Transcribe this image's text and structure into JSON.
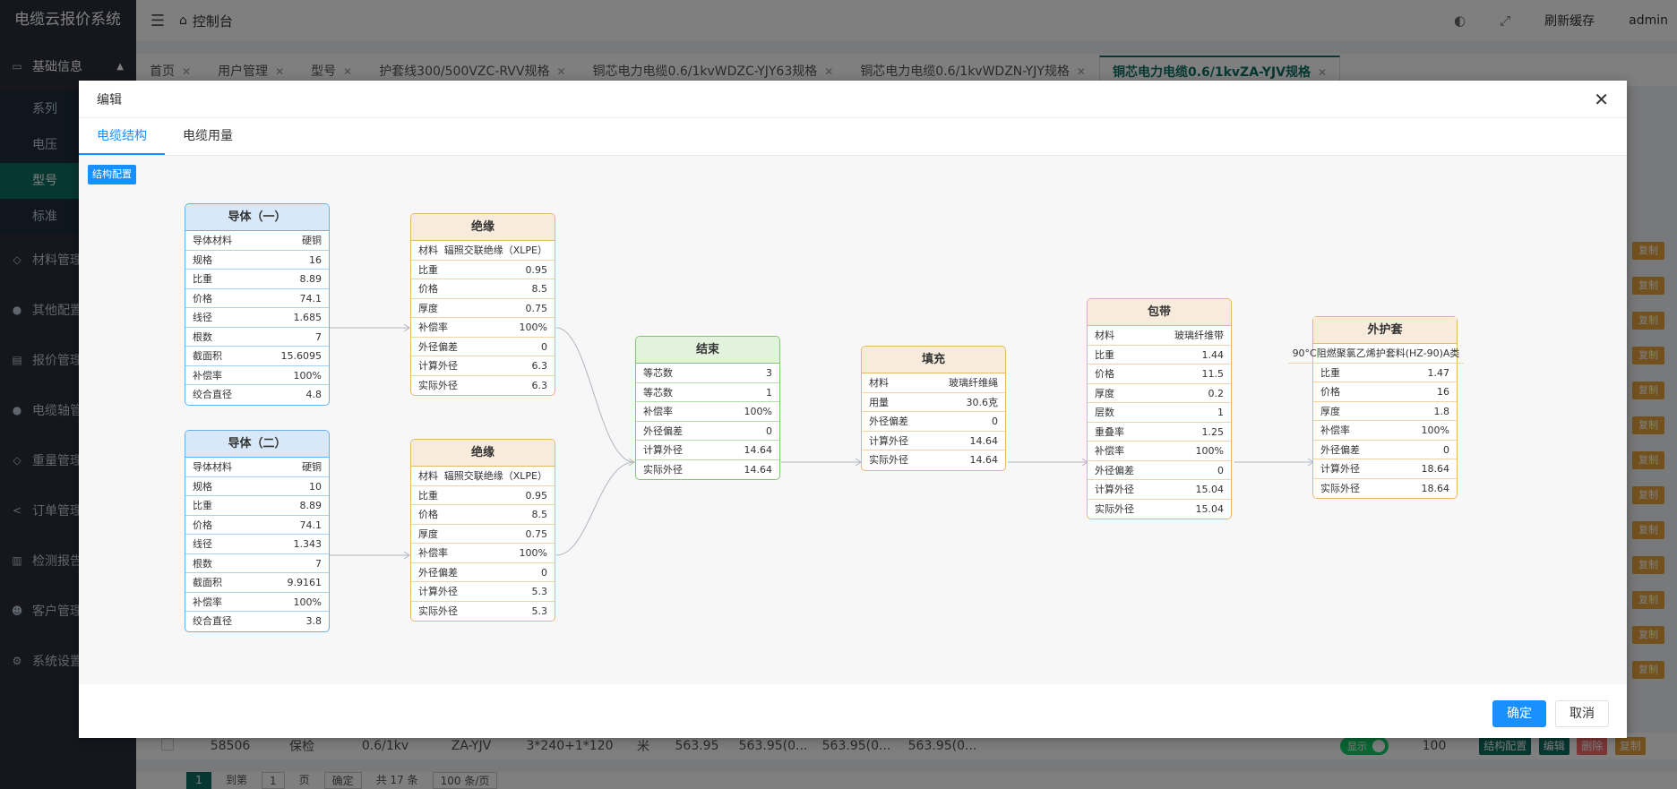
{
  "app": {
    "title": "电缆云报价系统",
    "breadcrumb": "控制台",
    "user": "admin",
    "refresh_cache": "刷新缓存"
  },
  "sidebar": {
    "items": [
      {
        "label": "基础信息",
        "icon": "monitor-icon"
      },
      {
        "label": "材料管理",
        "icon": "diamond-icon"
      },
      {
        "label": "其他配置",
        "icon": "globe-icon"
      },
      {
        "label": "报价管理",
        "icon": "document-icon"
      },
      {
        "label": "电缆轴管理",
        "icon": "circle-icon"
      },
      {
        "label": "重量管理",
        "icon": "diamond-icon"
      },
      {
        "label": "订单管理",
        "icon": "share-icon"
      },
      {
        "label": "检测报告",
        "icon": "report-icon"
      },
      {
        "label": "客户管理",
        "icon": "users-icon"
      },
      {
        "label": "系统设置",
        "icon": "gear-icon"
      }
    ],
    "submenu": [
      "系列",
      "电压",
      "型号",
      "标准"
    ],
    "active_sub": "型号"
  },
  "tabs": [
    "首页",
    "用户管理",
    "型号",
    "护套线300/500VZC-RVV规格",
    "铜芯电力电缆0.6/1kvWDZC-YJY63规格",
    "铜芯电力电缆0.6/1kvWDZN-YJY规格",
    "铜芯电力电缆0.6/1kvZA-YJV规格"
  ],
  "table_row": {
    "id": "58506",
    "type": "保检",
    "voltage": "0.6/1kv",
    "model": "ZA-YJV",
    "spec": "3*240+1*120",
    "unit": "米",
    "price": "563.95",
    "p1": "563.95(0...",
    "p2": "563.95(0...",
    "p3": "563.95(0...",
    "status": "显示",
    "sort": "100",
    "btn_struct": "结构配置",
    "btn_edit": "编辑",
    "btn_delete": "删除",
    "btn_copy": "复制"
  },
  "pager": {
    "current": "1",
    "goto_label": "到第",
    "goto_value": "1",
    "page_unit": "页",
    "confirm": "确定",
    "total": "共 17 条",
    "page_size": "100 条/页"
  },
  "dialog": {
    "title": "编辑",
    "tabs": [
      "电缆结构",
      "电缆用量"
    ],
    "config_button": "结构配置",
    "ok": "确定",
    "cancel": "取消"
  },
  "nodes": {
    "conductor1": {
      "title": "导体（一）",
      "rows": [
        [
          "导体材料",
          "硬铜"
        ],
        [
          "规格",
          "16"
        ],
        [
          "比重",
          "8.89"
        ],
        [
          "价格",
          "74.1"
        ],
        [
          "线径",
          "1.685"
        ],
        [
          "根数",
          "7"
        ],
        [
          "截面积",
          "15.6095"
        ],
        [
          "补偿率",
          "100%"
        ],
        [
          "绞合直径",
          "4.8"
        ]
      ]
    },
    "conductor2": {
      "title": "导体（二）",
      "rows": [
        [
          "导体材料",
          "硬铜"
        ],
        [
          "规格",
          "10"
        ],
        [
          "比重",
          "8.89"
        ],
        [
          "价格",
          "74.1"
        ],
        [
          "线径",
          "1.343"
        ],
        [
          "根数",
          "7"
        ],
        [
          "截面积",
          "9.9161"
        ],
        [
          "补偿率",
          "100%"
        ],
        [
          "绞合直径",
          "3.8"
        ]
      ]
    },
    "insulation1": {
      "title": "绝缘",
      "rows": [
        [
          "材料",
          "辐照交联绝缘（XLPE）"
        ],
        [
          "比重",
          "0.95"
        ],
        [
          "价格",
          "8.5"
        ],
        [
          "厚度",
          "0.75"
        ],
        [
          "补偿率",
          "100%"
        ],
        [
          "外径偏差",
          "0"
        ],
        [
          "计算外径",
          "6.3"
        ],
        [
          "实际外径",
          "6.3"
        ]
      ]
    },
    "insulation2": {
      "title": "绝缘",
      "rows": [
        [
          "材料",
          "辐照交联绝缘（XLPE）"
        ],
        [
          "比重",
          "0.95"
        ],
        [
          "价格",
          "8.5"
        ],
        [
          "厚度",
          "0.75"
        ],
        [
          "补偿率",
          "100%"
        ],
        [
          "外径偏差",
          "0"
        ],
        [
          "计算外径",
          "5.3"
        ],
        [
          "实际外径",
          "5.3"
        ]
      ]
    },
    "bundle": {
      "title": "结束",
      "rows": [
        [
          "等芯数",
          "3"
        ],
        [
          "等芯数",
          "1"
        ],
        [
          "补偿率",
          "100%"
        ],
        [
          "外径偏差",
          "0"
        ],
        [
          "计算外径",
          "14.64"
        ],
        [
          "实际外径",
          "14.64"
        ]
      ]
    },
    "filler": {
      "title": "填充",
      "rows": [
        [
          "材料",
          "玻璃纤维绳"
        ],
        [
          "用量",
          "30.6克"
        ],
        [
          "外径偏差",
          "0"
        ],
        [
          "计算外径",
          "14.64"
        ],
        [
          "实际外径",
          "14.64"
        ]
      ]
    },
    "tape": {
      "title": "包带",
      "rows": [
        [
          "材料",
          "玻璃纤维带"
        ],
        [
          "比重",
          "1.44"
        ],
        [
          "价格",
          "11.5"
        ],
        [
          "厚度",
          "0.2"
        ],
        [
          "层数",
          "1"
        ],
        [
          "重叠率",
          "1.25"
        ],
        [
          "补偿率",
          "100%"
        ],
        [
          "外径偏差",
          "0"
        ],
        [
          "计算外径",
          "15.04"
        ],
        [
          "实际外径",
          "15.04"
        ]
      ]
    },
    "sheath": {
      "title": "外护套",
      "material": "90°C阻燃聚氯乙烯护套料(HZ-90)A类",
      "rows": [
        [
          "比重",
          "1.47"
        ],
        [
          "价格",
          "16"
        ],
        [
          "厚度",
          "1.8"
        ],
        [
          "补偿率",
          "100%"
        ],
        [
          "外径偏差",
          "0"
        ],
        [
          "计算外径",
          "18.64"
        ],
        [
          "实际外径",
          "18.64"
        ]
      ]
    }
  },
  "colors": {
    "accent": "#1890ff",
    "sidebar_active": "#0e6e62",
    "conductor": "#66aff0",
    "layer": "#e9b56a",
    "bundle": "#7bc86c"
  }
}
